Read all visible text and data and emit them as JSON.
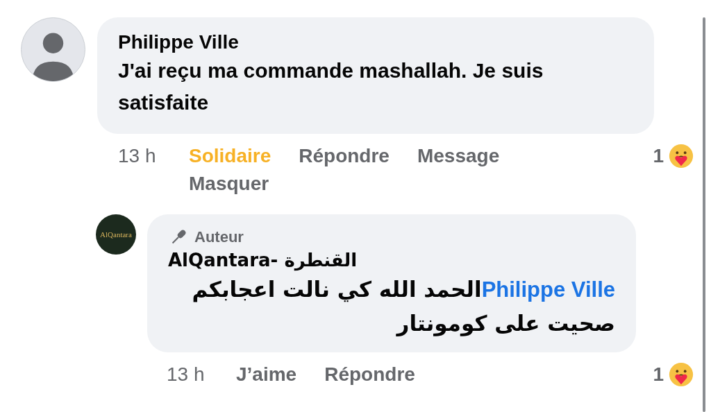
{
  "comments": [
    {
      "author": "Philippe Ville",
      "avatar": {
        "kind": "silhouette"
      },
      "text": "J'ai reçu ma commande mashallah. Je suis satisfaite",
      "time": "13 h",
      "reaction": {
        "label": "Solidaire",
        "selected": true
      },
      "actions": [
        "Répondre",
        "Message",
        "Masquer"
      ],
      "reaction_count": "1",
      "replies": [
        {
          "author": "AlQantara- القنطرة",
          "badge": "Auteur",
          "avatar": {
            "kind": "logo",
            "text": "AlQantara"
          },
          "mention": "Philippe Ville",
          "text": "الحمد الله كي نالت اعجابكم صحيت على كومونتار",
          "time": "13 h",
          "reaction": {
            "label": "J’aime",
            "selected": false
          },
          "actions": [
            "Répondre"
          ],
          "reaction_count": "1"
        }
      ]
    }
  ]
}
